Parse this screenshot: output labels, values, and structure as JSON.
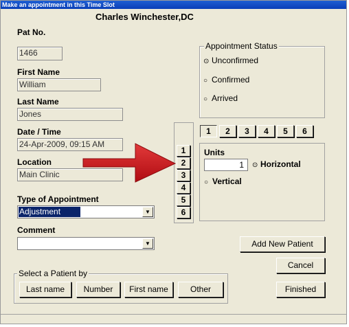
{
  "window": {
    "title": "Make an appointment in this Time Slot",
    "subtitle": "Charles Winchester,DC"
  },
  "patient": {
    "pat_no_label": "Pat No.",
    "pat_no_value": "1466",
    "first_name_label": "First Name",
    "first_name_value": "William",
    "last_name_label": "Last Name",
    "last_name_value": "Jones",
    "datetime_label": "Date / Time",
    "datetime_value": "24-Apr-2009, 09:15 AM",
    "location_label": "Location",
    "location_value": "Main Clinic"
  },
  "appointment": {
    "type_label": "Type of Appointment",
    "type_value": "Adjustment",
    "comment_label": "Comment",
    "comment_value": ""
  },
  "status": {
    "title": "Appointment Status",
    "options": [
      "Unconfirmed",
      "Confirmed",
      "Arrived"
    ],
    "selected": "Unconfirmed"
  },
  "slots": {
    "column_numbers": [
      "1",
      "2",
      "3",
      "4",
      "5",
      "6"
    ],
    "tab_numbers": [
      "1",
      "2",
      "3",
      "4",
      "5",
      "6"
    ],
    "units_label": "Units",
    "units_value": "1",
    "orientation_options": [
      "Horizontal",
      "Vertical"
    ],
    "orientation_selected": "Horizontal"
  },
  "select_patient": {
    "title": "Select a Patient by",
    "buttons": [
      "Last name",
      "Number",
      "First name",
      "Other"
    ]
  },
  "actions": {
    "add_new_patient": "Add New Patient",
    "cancel": "Cancel",
    "finished": "Finished"
  },
  "colors": {
    "title_bar": "#0a3fb8",
    "window_bg": "#ece9d8",
    "selection": "#0a246a",
    "arrow": "#c8141a"
  }
}
